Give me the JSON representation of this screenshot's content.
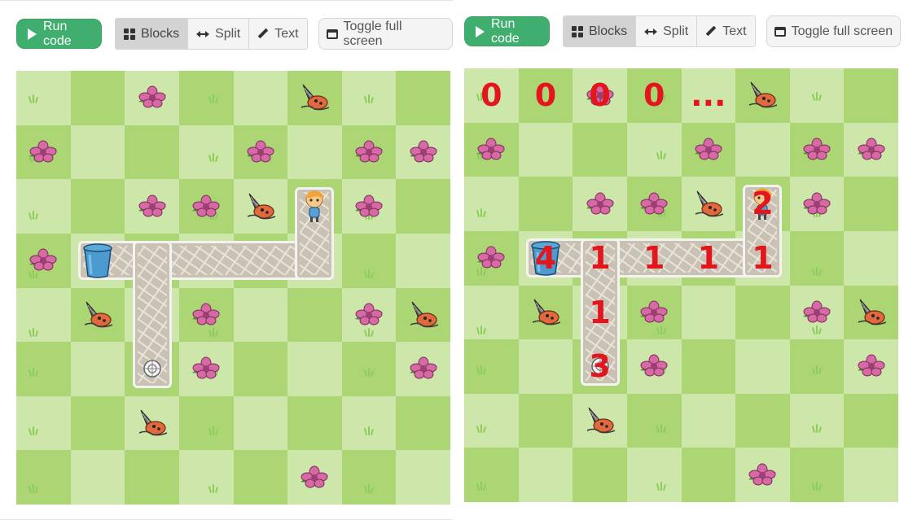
{
  "toolbar": {
    "run_label": "Run code",
    "blocks_label": "Blocks",
    "split_label": "Split",
    "text_label": "Text",
    "fullscreen_label": "Toggle full screen",
    "active_mode": "Blocks"
  },
  "colors": {
    "run_green": "#3fae6e",
    "grass_light": "#cde6a9",
    "grass_dark": "#abd673",
    "path": "#c9c2b4",
    "annotation_red": "#e4161d"
  },
  "board": {
    "rows": 8,
    "cols": 8,
    "flowers": [
      [
        0,
        2
      ],
      [
        1,
        0
      ],
      [
        1,
        4
      ],
      [
        1,
        6
      ],
      [
        1,
        7
      ],
      [
        2,
        2
      ],
      [
        2,
        3
      ],
      [
        2,
        6
      ],
      [
        3,
        0
      ],
      [
        4,
        3
      ],
      [
        4,
        6
      ],
      [
        5,
        3
      ],
      [
        5,
        7
      ],
      [
        7,
        5
      ]
    ],
    "drills": [
      [
        0,
        5
      ],
      [
        2,
        4
      ],
      [
        4,
        1
      ],
      [
        4,
        7
      ],
      [
        6,
        2
      ]
    ],
    "path": {
      "horizontal": {
        "row": 3,
        "from_col": 1,
        "to_col": 5
      },
      "up": {
        "col": 5,
        "from_row": 2,
        "to_row": 3
      },
      "down": {
        "col": 2,
        "from_row": 3,
        "to_row": 5
      }
    },
    "trash_can": [
      3,
      1
    ],
    "character": [
      2,
      5
    ],
    "target": [
      5,
      2
    ]
  },
  "annotations": [
    {
      "text": "0",
      "cell": [
        0,
        0
      ]
    },
    {
      "text": "0",
      "cell": [
        0,
        1
      ]
    },
    {
      "text": "0",
      "cell": [
        0,
        2
      ]
    },
    {
      "text": "0",
      "cell": [
        0,
        3
      ]
    },
    {
      "text": "...",
      "cell": [
        0,
        4
      ]
    },
    {
      "text": "2",
      "cell": [
        2,
        5
      ]
    },
    {
      "text": "4",
      "cell": [
        3,
        1
      ]
    },
    {
      "text": "1",
      "cell": [
        3,
        2
      ]
    },
    {
      "text": "1",
      "cell": [
        3,
        3
      ]
    },
    {
      "text": "1",
      "cell": [
        3,
        4
      ]
    },
    {
      "text": "1",
      "cell": [
        3,
        5
      ]
    },
    {
      "text": "1",
      "cell": [
        4,
        2
      ]
    },
    {
      "text": "3",
      "cell": [
        5,
        2
      ]
    }
  ]
}
